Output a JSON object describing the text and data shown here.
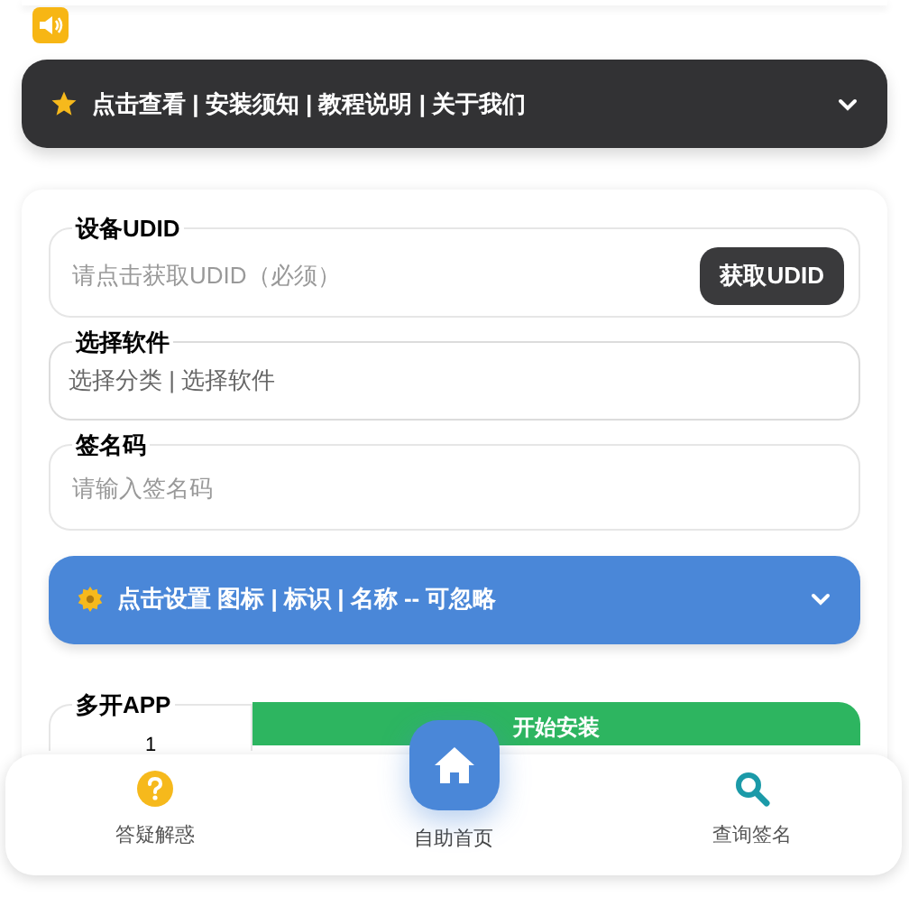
{
  "notice_bar": {
    "title": "点击查看 | 安装须知 | 教程说明 | 关于我们",
    "expanded": false
  },
  "form": {
    "udid": {
      "label": "设备UDID",
      "placeholder": "请点击获取UDID（必须）",
      "button": "获取UDID"
    },
    "software": {
      "label": "选择软件",
      "value": "选择分类 | 选择软件"
    },
    "sign_code": {
      "label": "签名码",
      "placeholder": "请输入签名码"
    },
    "settings_bar": {
      "title": "点击设置 图标 | 标识 | 名称 -- 可忽略",
      "expanded": false
    },
    "multi_open": {
      "label": "多开APP",
      "value": "1"
    },
    "install_button": "开始安装"
  },
  "bottom_nav": [
    {
      "kind": "help",
      "label": "答疑解惑",
      "selected": false
    },
    {
      "kind": "home",
      "label": "自助首页",
      "selected": true
    },
    {
      "kind": "search",
      "label": "查询签名",
      "selected": false
    }
  ]
}
